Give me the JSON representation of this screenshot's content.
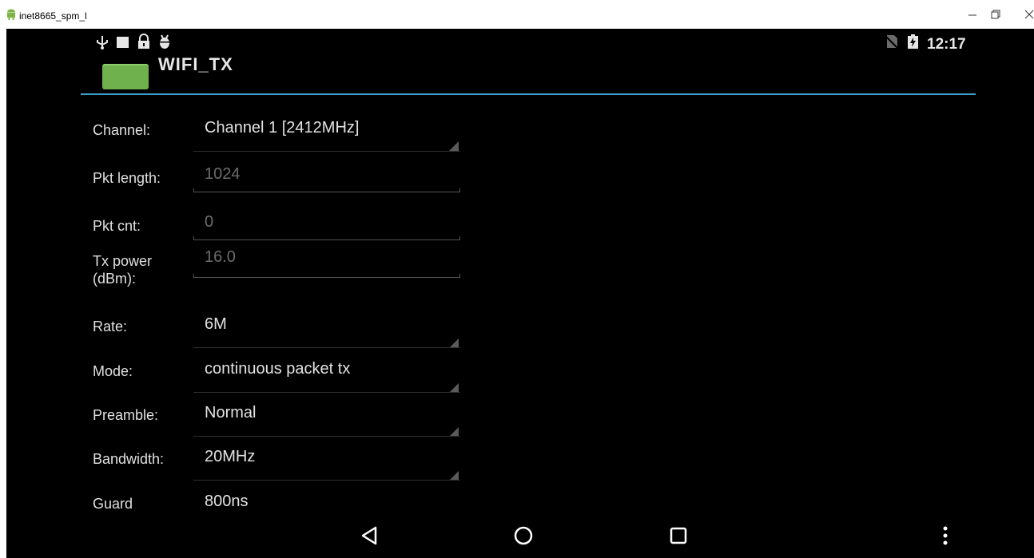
{
  "window": {
    "title": "inet8665_spm_l"
  },
  "status_bar": {
    "time": "12:17"
  },
  "action_bar": {
    "title": "WIFI_TX"
  },
  "form": {
    "channel": {
      "label": "Channel:",
      "value": "Channel 1 [2412MHz]"
    },
    "pkt_length": {
      "label": "Pkt length:",
      "value": "1024"
    },
    "pkt_cnt": {
      "label": "Pkt cnt:",
      "value": "0"
    },
    "tx_power": {
      "label": "Tx power (dBm):",
      "value": "16.0"
    },
    "rate": {
      "label": "Rate:",
      "value": "6M"
    },
    "mode": {
      "label": "Mode:",
      "value": "continuous packet tx"
    },
    "preamble": {
      "label": "Preamble:",
      "value": "Normal"
    },
    "bandwidth": {
      "label": "Bandwidth:",
      "value": "20MHz"
    },
    "guard": {
      "label": "Guard",
      "value": "800ns"
    }
  },
  "icons": {
    "window": [
      "android-icon",
      "minimize-icon",
      "restore-icon",
      "close-icon"
    ],
    "status_bar": [
      "usb-icon",
      "notification-square-icon",
      "lock-icon",
      "android-debug-icon",
      "no-sim-icon",
      "battery-charging-icon"
    ],
    "nav_bar": [
      "back-icon",
      "home-icon",
      "recents-icon",
      "overflow-menu-icon"
    ]
  },
  "colors": {
    "screen_background": "#000000",
    "accent_divider": "#3f9fcc",
    "app_logo": "#6fb24d"
  }
}
